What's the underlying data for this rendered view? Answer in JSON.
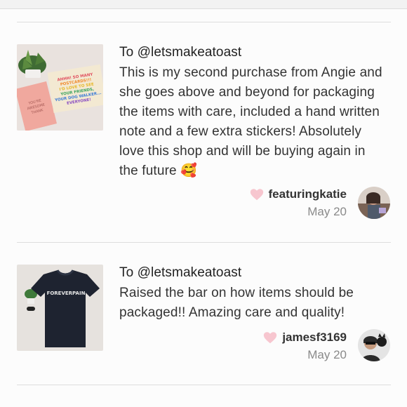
{
  "reviews": [
    {
      "to_prefix": "To ",
      "to_handle": "@letsmakeatoast",
      "text": "This is my second purchase from Angie and she goes above and beyond for packaging the items with care, included a hand written note and a few extra stickers! Absolutely love this shop and will be buying again in the future 🥰",
      "username": "featuringkatie",
      "date": "May 20",
      "thumb_note_text": "AHHH! SO MANY POSTCARDS!!! I'D LOVE TO SEE YOUR FRIENDS, YOUR BOSS, YOUR DOG WALKER... EVERYONE!",
      "thumb_card_text": "YOU'RE AWESOME THANK YOU!"
    },
    {
      "to_prefix": "To ",
      "to_handle": "@letsmakeatoast",
      "text": "Raised the bar on how items should be packaged!! Amazing care and quality!",
      "username": "jamesf3169",
      "date": "May 20",
      "thumb_shirt_text": "FOREVERPAIN"
    }
  ],
  "icons": {
    "like": "heart-icon",
    "heart_color": "#f7c6cf"
  }
}
